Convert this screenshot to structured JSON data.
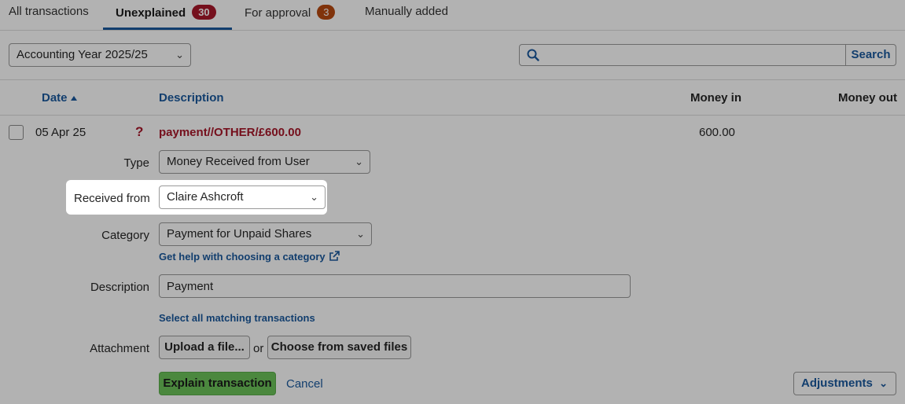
{
  "tabs": [
    {
      "label": "All transactions"
    },
    {
      "label": "Unexplained",
      "count": "30"
    },
    {
      "label": "For approval",
      "count": "3"
    },
    {
      "label": "Manually added"
    }
  ],
  "filters": {
    "year": "Accounting Year 2025/25",
    "search_value": "",
    "search_button": "Search"
  },
  "table": {
    "headers": {
      "date": "Date",
      "description": "Description",
      "money_in": "Money in",
      "money_out": "Money out"
    },
    "row": {
      "date": "05 Apr 25",
      "flag": "?",
      "description": "payment//OTHER/£600.00",
      "money_in": "600.00"
    }
  },
  "form": {
    "type_label": "Type",
    "type_value": "Money Received from User",
    "received_from_label": "Received from",
    "received_from_value": "Claire Ashcroft",
    "category_label": "Category",
    "category_value": "Payment for Unpaid Shares",
    "category_help": "Get help with choosing a category",
    "description_label": "Description",
    "description_value": "Payment",
    "select_matching": "Select all matching transactions",
    "attachment_label": "Attachment",
    "upload_button": "Upload a file...",
    "or_text": "or",
    "saved_files_button": "Choose from saved files",
    "explain_button": "Explain transaction",
    "cancel_link": "Cancel",
    "adjustments_button": "Adjustments"
  },
  "colors": {
    "accent": "#1b5a9e",
    "danger": "#a8182a",
    "warning": "#b84a10",
    "primary_button": "#6cc35a"
  }
}
